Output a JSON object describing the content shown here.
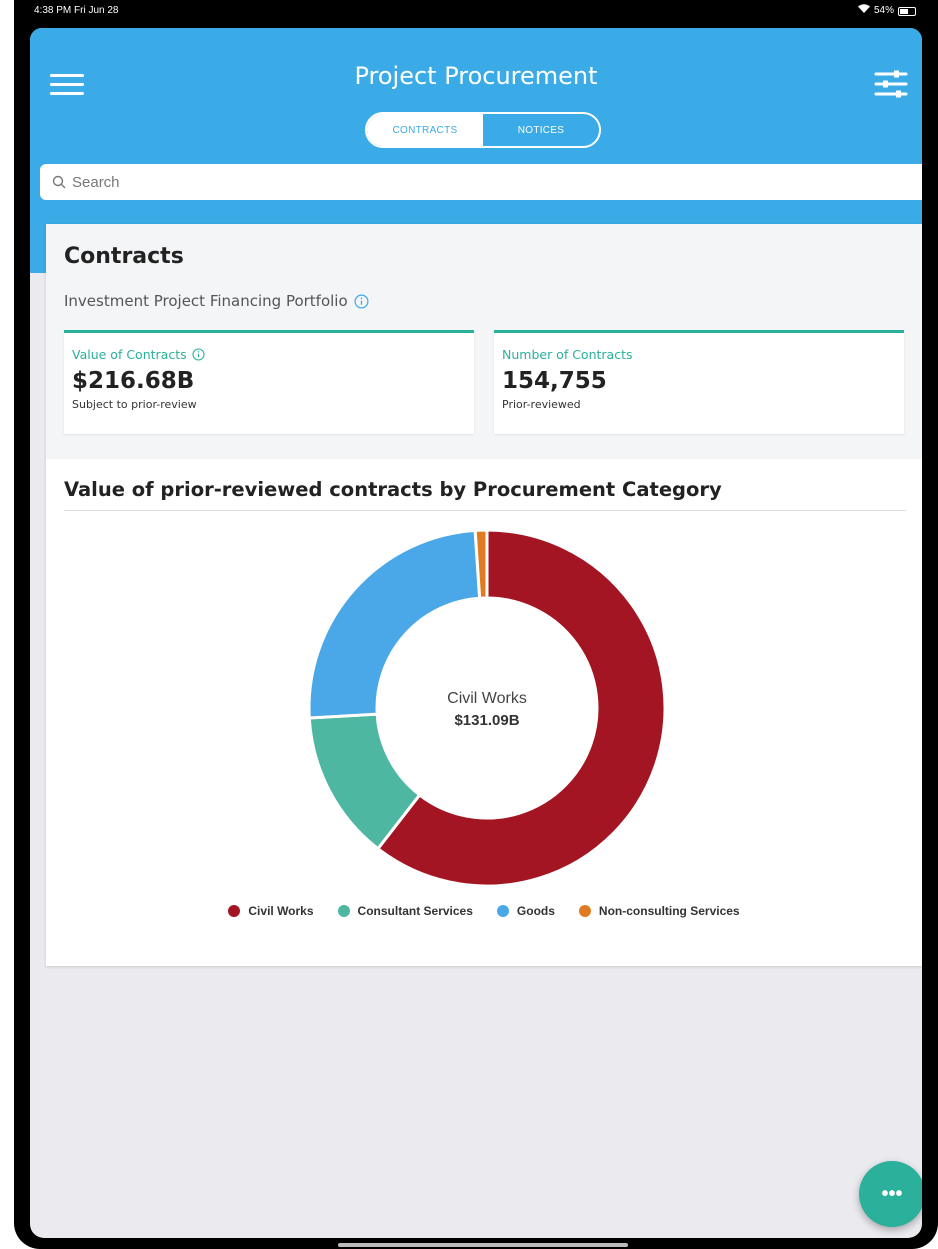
{
  "status_bar": {
    "time": "4:38 PM  Fri Jun 28",
    "battery": "54%"
  },
  "header": {
    "title": "Project Procurement",
    "tabs": [
      {
        "label": "CONTRACTS",
        "active": true
      },
      {
        "label": "NOTICES",
        "active": false
      }
    ]
  },
  "search": {
    "placeholder": "Search"
  },
  "contracts": {
    "title": "Contracts",
    "portfolio_label": "Investment Project Financing Portfolio",
    "stats": [
      {
        "label": "Value of Contracts",
        "value": "$216.68B",
        "sub": "Subject to prior-review"
      },
      {
        "label": "Number of Contracts",
        "value": "154,755",
        "sub": "Prior-reviewed"
      }
    ]
  },
  "chart_title": "Value of prior-reviewed contracts by Procurement Category",
  "chart_data": {
    "type": "pie",
    "center_label": "Civil Works",
    "center_value": "$131.09B",
    "categories": [
      "Civil Works",
      "Consultant Services",
      "Goods",
      "Non-consulting Services"
    ],
    "values": [
      131.09,
      29.5,
      53.8,
      2.3
    ],
    "colors": [
      "#a31523",
      "#4eb7a1",
      "#4aa8e8",
      "#e07b24"
    ],
    "donut": true
  },
  "colors": {
    "header": "#3aabe6",
    "accent": "#2ab09b"
  },
  "fab": {
    "label": "•••"
  }
}
